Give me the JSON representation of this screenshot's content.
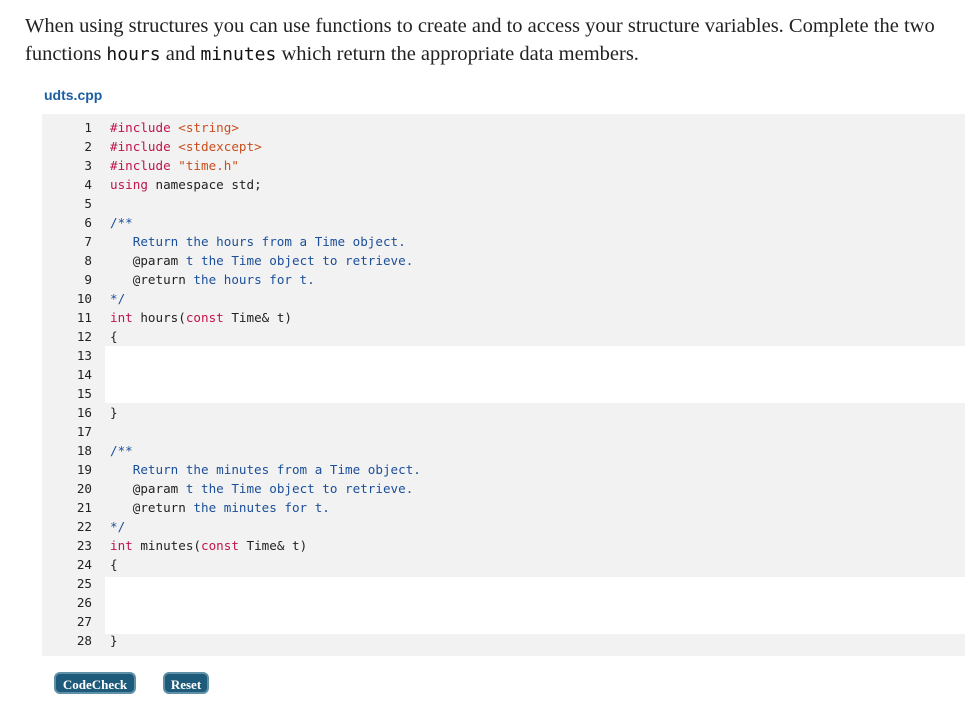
{
  "instructions": {
    "part1": "When using structures you can use functions to create and to access your structure variables. Complete the two functions ",
    "fn_hours": "hours",
    "part2": " and ",
    "fn_minutes": "minutes",
    "part3": " which return the appropriate data members."
  },
  "filename": "udts.cpp",
  "code": {
    "l1": {
      "num": "1",
      "kw": "#include ",
      "str": "<string>"
    },
    "l2": {
      "num": "2",
      "kw": "#include ",
      "str": "<stdexcept>"
    },
    "l3": {
      "num": "3",
      "kw": "#include ",
      "str": "\"time.h\""
    },
    "l4": {
      "num": "4",
      "kw": "using",
      "rest": " namespace std;"
    },
    "l5": {
      "num": "5"
    },
    "l6": {
      "num": "6",
      "cm": "/**"
    },
    "l7": {
      "num": "7",
      "cm": "   Return the hours from a Time object."
    },
    "l8": {
      "num": "8",
      "tag": "   @param",
      "cm": " t the Time object to retrieve."
    },
    "l9": {
      "num": "9",
      "tag": "   @return",
      "cm": " the hours for t."
    },
    "l10": {
      "num": "10",
      "cm": "*/"
    },
    "l11": {
      "num": "11",
      "kw": "int",
      "rest": " hours(",
      "kw2": "const",
      "rest2": " Time& t)"
    },
    "l12": {
      "num": "12",
      "rest": "{"
    },
    "l13": {
      "num": "13"
    },
    "l14": {
      "num": "14"
    },
    "l15": {
      "num": "15"
    },
    "l16": {
      "num": "16",
      "rest": "}"
    },
    "l17": {
      "num": "17"
    },
    "l18": {
      "num": "18",
      "cm": "/**"
    },
    "l19": {
      "num": "19",
      "cm": "   Return the minutes from a Time object."
    },
    "l20": {
      "num": "20",
      "tag": "   @param",
      "cm": " t the Time object to retrieve."
    },
    "l21": {
      "num": "21",
      "tag": "   @return",
      "cm": " the minutes for t."
    },
    "l22": {
      "num": "22",
      "cm": "*/"
    },
    "l23": {
      "num": "23",
      "kw": "int",
      "rest": " minutes(",
      "kw2": "const",
      "rest2": " Time& t)"
    },
    "l24": {
      "num": "24",
      "rest": "{"
    },
    "l25": {
      "num": "25"
    },
    "l26": {
      "num": "26"
    },
    "l27": {
      "num": "27"
    },
    "l28": {
      "num": "28",
      "rest": "}"
    }
  },
  "buttons": {
    "codecheck": "CodeCheck",
    "reset": "Reset"
  },
  "colors": {
    "button_bg": "#1e5a7a",
    "filename": "#1b5ea1",
    "keyword": "#c0144a",
    "string": "#c94f1f",
    "comment": "#1b4f9a",
    "editor_bg": "#f2f2f2"
  }
}
